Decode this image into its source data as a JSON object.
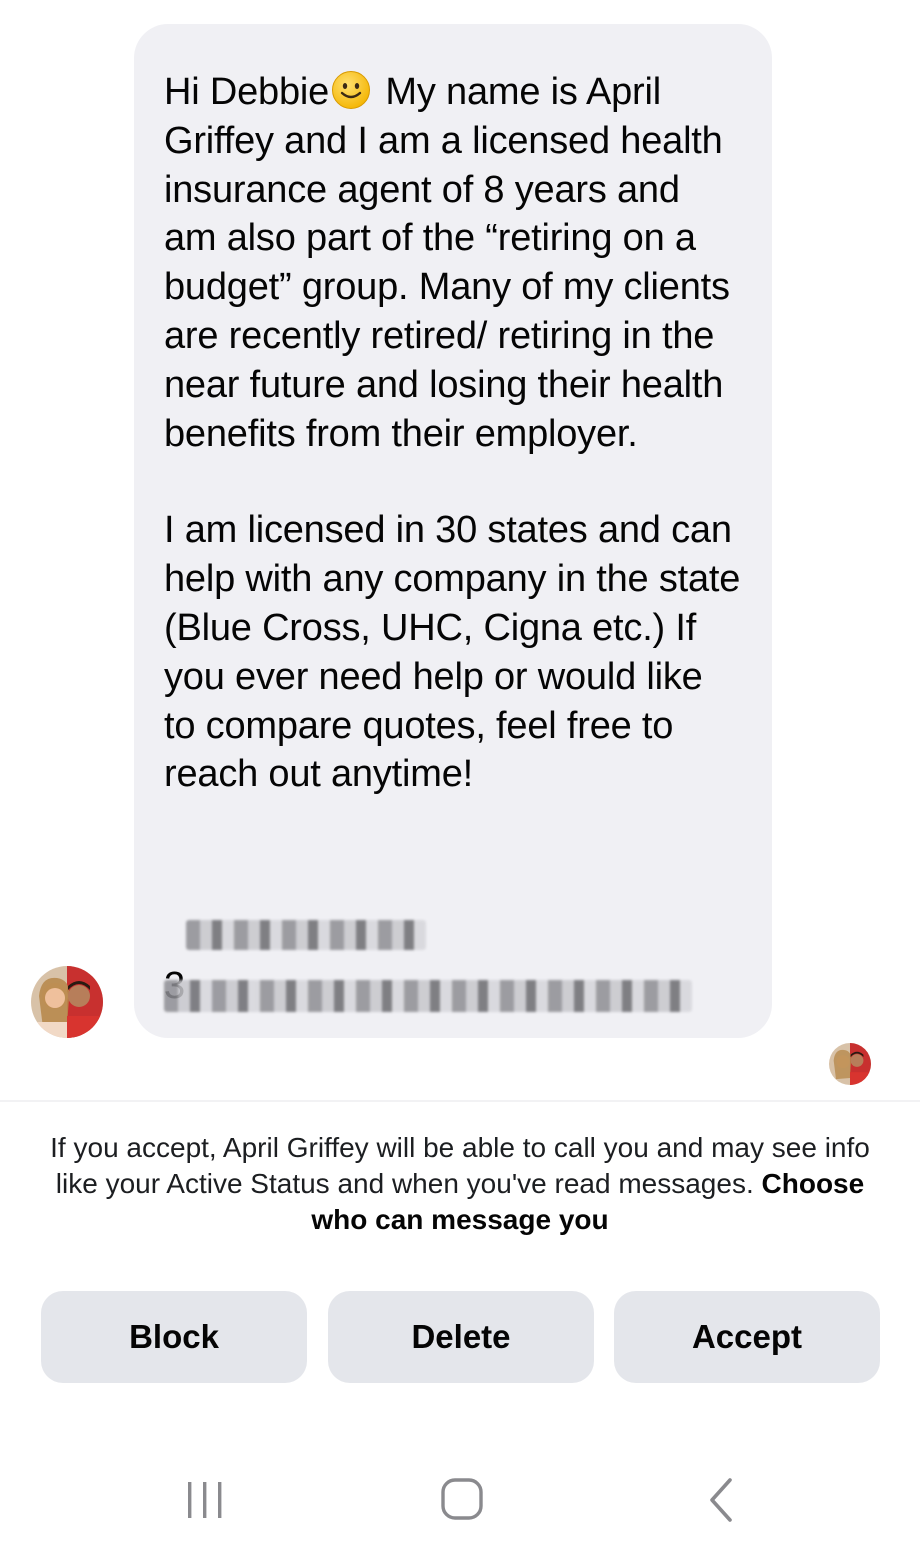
{
  "message": {
    "greeting_before_emoji": "Hi Debbie",
    "emoji": "smiling-face-emoji",
    "paragraph1_after_emoji": " My name is April Griffey and I am a licensed health insurance agent of 8 years and am also part of the “retiring on a budget” group. Many of my clients are recently retired/ retiring in the near future and losing their health benefits from their employer.",
    "paragraph2": "I am licensed in 30 states and can help with any company in the state (Blue Cross, UHC, Cigna etc.) If you ever need help or would like to compare quotes, feel free to reach out anytime!",
    "redacted_phone_first_char": "3"
  },
  "notice": {
    "text": "If you accept, April Griffey will be able to call you and may see info like your Active Status and when you've read messages.",
    "link": "Choose who can message you"
  },
  "actions": {
    "block_label": "Block",
    "delete_label": "Delete",
    "accept_label": "Accept"
  },
  "navbar": {
    "recents_icon": "recent-apps-icon",
    "home_icon": "home-icon",
    "back_icon": "back-icon"
  },
  "colors": {
    "bubble": "#f0f0f4",
    "button": "#e4e6eb",
    "text": "#050505"
  }
}
